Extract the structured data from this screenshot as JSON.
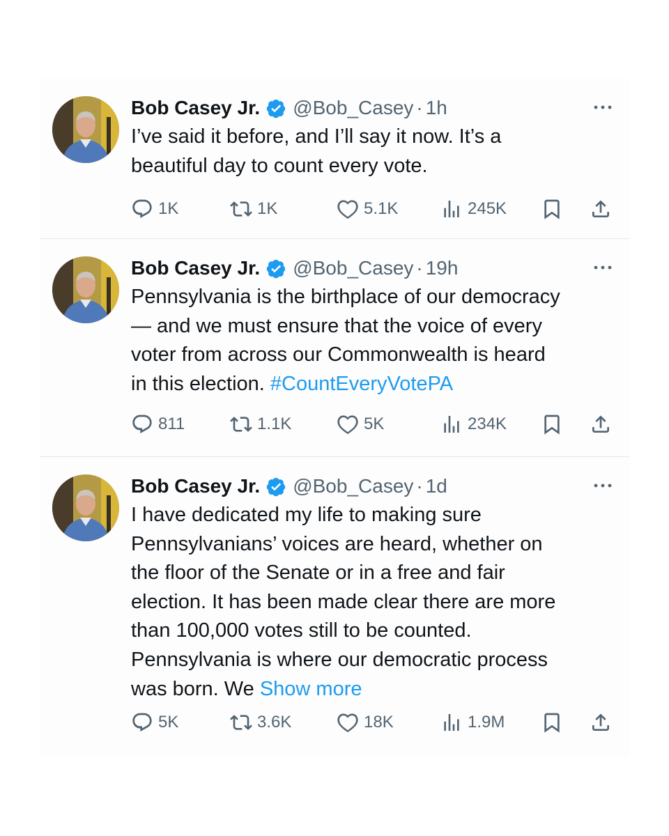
{
  "tweets": [
    {
      "name": "Bob Casey Jr.",
      "handle": "@Bob_Casey",
      "dot": "·",
      "time": "1h",
      "text": "I’ve said it before, and I’ll say it now. It’s a\nbeautiful day to count every vote.",
      "hashtag": "",
      "show_more": "",
      "replies": "1K",
      "reposts": "1K",
      "likes": "5.1K",
      "views": "245K"
    },
    {
      "name": "Bob Casey Jr.",
      "handle": "@Bob_Casey",
      "dot": "·",
      "time": "19h",
      "text": "Pennsylvania is the birthplace of our democracy\n— and we must ensure that the voice of every\nvoter from across our Commonwealth is heard\nin this election. ",
      "hashtag": "#CountEveryVotePA",
      "show_more": "",
      "replies": "811",
      "reposts": "1.1K",
      "likes": "5K",
      "views": "234K"
    },
    {
      "name": "Bob Casey Jr.",
      "handle": "@Bob_Casey",
      "dot": "·",
      "time": "1d",
      "text": "I have dedicated my life to making sure\nPennsylvanians’ voices are heard, whether on\nthe floor of the Senate or in a free and fair\nelection. It has been made clear there are more\nthan 100,000 votes still to be counted.\nPennsylvania is where our democratic process\nwas born. We ",
      "hashtag": "",
      "show_more": "Show more",
      "replies": "5K",
      "reposts": "3.6K",
      "likes": "18K",
      "views": "1.9M"
    }
  ],
  "icons": {
    "verified": "verified-badge-icon",
    "more": "more-dots-icon",
    "reply": "reply-icon",
    "repost": "repost-icon",
    "like": "heart-icon",
    "views": "views-icon",
    "bookmark": "bookmark-icon",
    "share": "share-icon"
  },
  "colors": {
    "text": "#0f1419",
    "muted": "#536471",
    "link": "#1d9bf0",
    "verified": "#1d9bf0",
    "divider": "#e3e6e8"
  }
}
